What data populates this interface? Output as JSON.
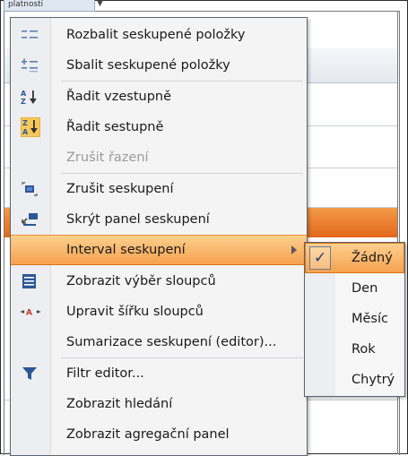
{
  "background": {
    "header_tab_text": "platnosti",
    "header_arrow": "▼",
    "accent_orange": "#e8792a"
  },
  "menu": {
    "items": [
      {
        "label": "Rozbalit seskupené položky",
        "icon": "expand-groups-icon",
        "disabled": false
      },
      {
        "label": "Sbalit seskupené položky",
        "icon": "collapse-groups-icon",
        "disabled": false
      },
      {
        "label": "Řadit vzestupně",
        "icon": "sort-ascending-icon",
        "disabled": false
      },
      {
        "label": "Řadit sestupně",
        "icon": "sort-descending-icon",
        "disabled": false
      },
      {
        "label": "Zrušit řazení",
        "icon": "",
        "disabled": true
      },
      {
        "label": "Zrušit seskupení",
        "icon": "ungroup-icon",
        "disabled": false
      },
      {
        "label": "Skrýt panel seskupení",
        "icon": "hide-group-panel-icon",
        "disabled": false
      },
      {
        "label": "Interval seskupení",
        "icon": "",
        "disabled": false,
        "highlighted": true,
        "has_submenu": true
      },
      {
        "label": "Zobrazit výběr sloupců",
        "icon": "column-chooser-icon",
        "disabled": false
      },
      {
        "label": "Upravit šířku sloupců",
        "icon": "best-fit-icon",
        "disabled": false
      },
      {
        "label": "Sumarizace seskupení (editor)...",
        "icon": "",
        "disabled": false
      },
      {
        "label": "Filtr editor...",
        "icon": "filter-icon",
        "disabled": false
      },
      {
        "label": "Zobrazit hledání",
        "icon": "",
        "disabled": false
      },
      {
        "label": "Zobrazit agregační panel",
        "icon": "",
        "disabled": false
      }
    ]
  },
  "submenu": {
    "check_glyph": "✓",
    "items": [
      {
        "label": "Žádný",
        "checked": true
      },
      {
        "label": "Den",
        "checked": false
      },
      {
        "label": "Měsíc",
        "checked": false
      },
      {
        "label": "Rok",
        "checked": false
      },
      {
        "label": "Chytrý",
        "checked": false
      }
    ]
  },
  "colors": {
    "highlight": "#f6a14f",
    "icon_blue": "#2b5797",
    "disabled_text": "#9b9b9b"
  }
}
